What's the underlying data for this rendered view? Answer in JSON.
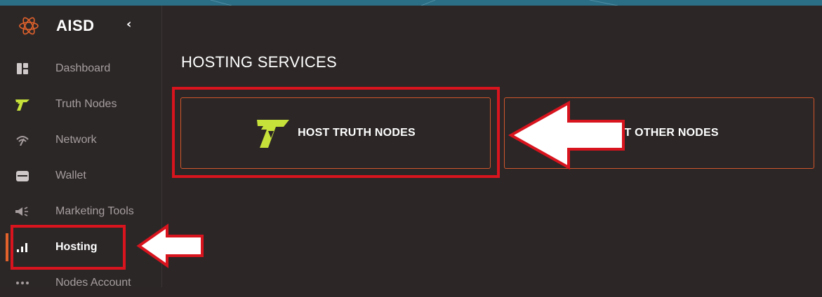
{
  "brand": {
    "name": "AISD",
    "collapse_icon": "‹"
  },
  "sidebar": {
    "items": [
      {
        "label": "Dashboard",
        "icon": "dashboard-icon"
      },
      {
        "label": "Truth Nodes",
        "icon": "truth-nodes-icon"
      },
      {
        "label": "Network",
        "icon": "network-icon"
      },
      {
        "label": "Wallet",
        "icon": "wallet-icon"
      },
      {
        "label": "Marketing Tools",
        "icon": "megaphone-icon"
      },
      {
        "label": "Hosting",
        "icon": "signal-bars-icon",
        "active": true
      },
      {
        "label": "Nodes Account",
        "icon": "dots-icon"
      }
    ]
  },
  "main": {
    "title": "HOSTING SERVICES",
    "cards": [
      {
        "label": "HOST TRUTH NODES",
        "icon": "truth-nodes-logo-icon"
      },
      {
        "label": "HOST OTHER NODES"
      }
    ]
  },
  "colors": {
    "background": "#2c2626",
    "accent": "#e2622b",
    "card_border": "#d0572b",
    "truth_green": "#c6e23a",
    "annotation_red": "#d8141e"
  }
}
